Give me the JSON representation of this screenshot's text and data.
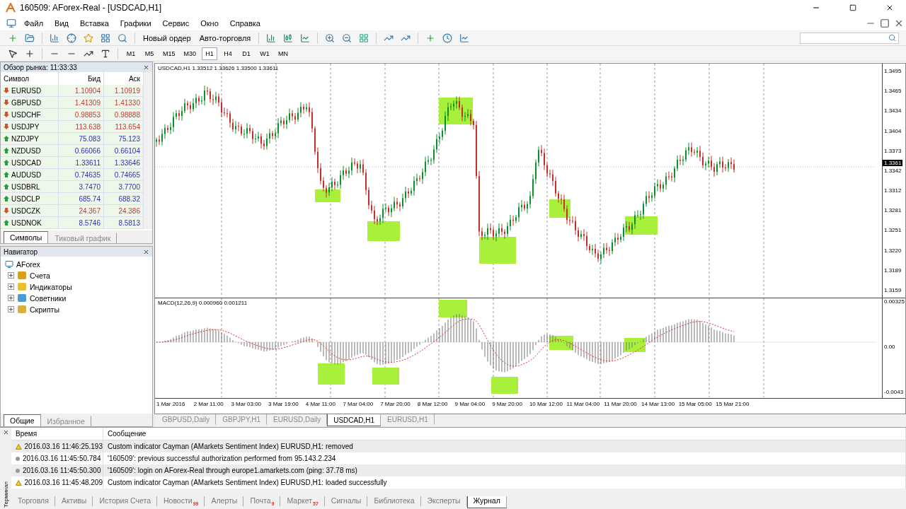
{
  "window": {
    "title": "160509: AForex-Real - [USDCAD,H1]"
  },
  "menu": [
    "Файл",
    "Вид",
    "Вставка",
    "Графики",
    "Сервис",
    "Окно",
    "Справка"
  ],
  "toolbar": {
    "buttons": [
      {
        "label": "Новый ордер"
      },
      {
        "label": "Авто-торговля"
      }
    ]
  },
  "timeframes": [
    {
      "label": "M1",
      "selected": false
    },
    {
      "label": "M5",
      "selected": false
    },
    {
      "label": "M15",
      "selected": false
    },
    {
      "label": "M30",
      "selected": false
    },
    {
      "label": "H1",
      "selected": true
    },
    {
      "label": "H4",
      "selected": false
    },
    {
      "label": "D1",
      "selected": false
    },
    {
      "label": "W1",
      "selected": false
    },
    {
      "label": "MN",
      "selected": false
    }
  ],
  "market_watch": {
    "title": "Обзор рынка: 11:33:33",
    "columns": [
      "Символ",
      "Бид",
      "Аск"
    ],
    "rows": [
      {
        "symbol": "EURUSD",
        "bid": "1.10904",
        "ask": "1.10919",
        "rising": false
      },
      {
        "symbol": "GBPUSD",
        "bid": "1.41309",
        "ask": "1.41330",
        "rising": false
      },
      {
        "symbol": "USDCHF",
        "bid": "0.98853",
        "ask": "0.98888",
        "rising": false
      },
      {
        "symbol": "USDJPY",
        "bid": "113.638",
        "ask": "113.654",
        "rising": false
      },
      {
        "symbol": "NZDJPY",
        "bid": "75.083",
        "ask": "75.123",
        "rising": true
      },
      {
        "symbol": "NZDUSD",
        "bid": "0.66066",
        "ask": "0.66104",
        "rising": true
      },
      {
        "symbol": "USDCAD",
        "bid": "1.33611",
        "ask": "1.33646",
        "rising": true
      },
      {
        "symbol": "AUDUSD",
        "bid": "0.74635",
        "ask": "0.74665",
        "rising": true
      },
      {
        "symbol": "USDBRL",
        "bid": "3.7470",
        "ask": "3.7700",
        "rising": true
      },
      {
        "symbol": "USDCLP",
        "bid": "685.74",
        "ask": "688.32",
        "rising": true
      },
      {
        "symbol": "USDCZK",
        "bid": "24.367",
        "ask": "24.386",
        "rising": false
      },
      {
        "symbol": "USDNOK",
        "bid": "8.5746",
        "ask": "8.5813",
        "rising": true
      }
    ],
    "tabs": [
      {
        "label": "Символы",
        "selected": true
      },
      {
        "label": "Тиковый график",
        "selected": false
      }
    ]
  },
  "navigator": {
    "title": "Навигатор",
    "root": "AForex",
    "items": [
      {
        "label": "Счета",
        "kind": "accounts"
      },
      {
        "label": "Индикаторы",
        "kind": "indicators"
      },
      {
        "label": "Советники",
        "kind": "experts"
      },
      {
        "label": "Скрипты",
        "kind": "scripts"
      }
    ],
    "tabs": [
      {
        "label": "Общие",
        "selected": true
      },
      {
        "label": "Избранное",
        "selected": false
      }
    ]
  },
  "chart": {
    "header": "USDCAD,H1  1.33512 1.33626 1.33500 1.33611",
    "price_labels": [
      "1.3495",
      "1.3465",
      "1.3434",
      "1.3404",
      "1.3373",
      "1.3342",
      "1.3312",
      "1.3281",
      "1.3251",
      "1.3220",
      "1.3189",
      "1.3159"
    ],
    "current_price": "1.3361",
    "macd_label": "MACD(12,26,9) 0.000960 0.001211",
    "macd_labels": [
      "0.00325",
      "0.00",
      "-0.0043"
    ],
    "time_labels": [
      "1 Mar 2016",
      "2 Mar 11:00",
      "3 Mar 03:00",
      "3 Mar 19:00",
      "4 Mar 11:00",
      "7 Mar 04:00",
      "7 Mar 20:00",
      "8 Mar 12:00",
      "9 Mar 04:00",
      "9 Mar 20:00",
      "10 Mar 12:00",
      "11 Mar 04:00",
      "11 Mar 20:00",
      "14 Mar 13:00",
      "15 Mar 05:00",
      "15 Mar 21:00"
    ]
  },
  "chart_tabs": [
    {
      "label": "GBPUSD,Daily",
      "selected": false
    },
    {
      "label": "GBPJPY,H1",
      "selected": false
    },
    {
      "label": "EURUSD,Daily",
      "selected": false
    },
    {
      "label": "USDCAD,H1",
      "selected": true
    },
    {
      "label": "EURUSD,H1",
      "selected": false
    }
  ],
  "terminal": {
    "side_label": "Терминал",
    "columns": [
      "Время",
      "Сообщение"
    ],
    "rows": [
      {
        "kind": "warning",
        "time": "2016.03.16 11:46:25.193",
        "message": "Custom indicator Cayman (AMarkets Sentiment Index) EURUSD,H1: removed"
      },
      {
        "kind": "info",
        "time": "2016.03.16 11:45:50.784",
        "message": "'160509': previous successful authorization performed from 95.143.2.234"
      },
      {
        "kind": "info",
        "time": "2016.03.16 11:45:50.300",
        "message": "'160509': login on AForex-Real through europe1.amarkets.com (ping: 37.78 ms)"
      },
      {
        "kind": "warning",
        "time": "2016.03.16 11:45:48.209",
        "message": "Custom indicator Cayman (AMarkets Sentiment Index) EURUSD,H1: loaded successfully"
      }
    ],
    "tabs": [
      {
        "label": "Торговля",
        "selected": false
      },
      {
        "label": "Активы",
        "selected": false
      },
      {
        "label": "История Счета",
        "selected": false
      },
      {
        "label": "Новости",
        "badge": "99",
        "selected": false
      },
      {
        "label": "Алерты",
        "selected": false
      },
      {
        "label": "Почта",
        "badge": "9",
        "selected": false
      },
      {
        "label": "Маркет",
        "badge": "57",
        "selected": false
      },
      {
        "label": "Сигналы",
        "selected": false
      },
      {
        "label": "Библиотека",
        "selected": false
      },
      {
        "label": "Эксперты",
        "selected": false
      },
      {
        "label": "Журнал",
        "selected": true
      }
    ]
  }
}
